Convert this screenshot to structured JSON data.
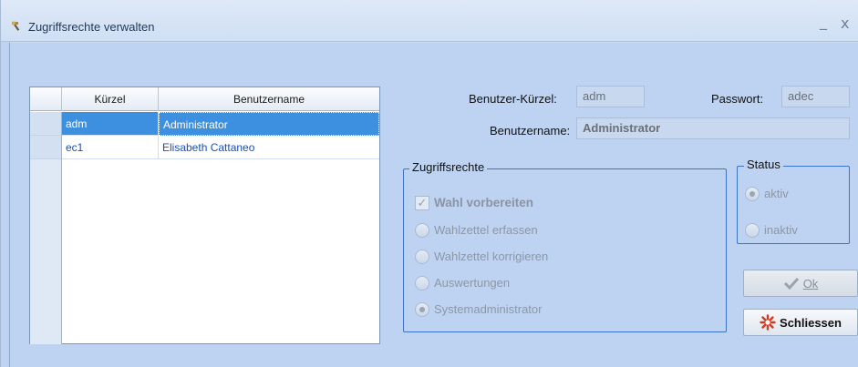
{
  "window": {
    "title": "Zugriffsrechte verwalten",
    "minimize_glyph": "_",
    "close_glyph": "x"
  },
  "grid": {
    "columns": [
      "Kürzel",
      "Benutzername"
    ],
    "rows": [
      {
        "kuerzel": "adm",
        "benutzername": "Administrator",
        "selected": true
      },
      {
        "kuerzel": "ec1",
        "benutzername": "Elisabeth Cattaneo",
        "selected": false
      }
    ]
  },
  "form": {
    "kuerzel_label": "Benutzer-Kürzel:",
    "kuerzel_value": "adm",
    "passwort_label": "Passwort:",
    "passwort_value": "adec",
    "benutzername_label": "Benutzername:",
    "benutzername_value": "Administrator"
  },
  "zugriffsrechte": {
    "title": "Zugriffsrechte",
    "checkbox": {
      "label": "Wahl vorbereiten",
      "checked": true
    },
    "options": [
      {
        "label": "Wahlzettel erfassen",
        "checked": false
      },
      {
        "label": "Wahlzettel korrigieren",
        "checked": false
      },
      {
        "label": "Auswertungen",
        "checked": false
      },
      {
        "label": "Systemadministrator",
        "checked": true
      }
    ]
  },
  "status": {
    "title": "Status",
    "options": [
      {
        "label": "aktiv",
        "checked": true
      },
      {
        "label": "inaktiv",
        "checked": false
      }
    ]
  },
  "buttons": {
    "ok_label": "Ok",
    "close_label": "Schliessen"
  },
  "colors": {
    "accent": "#3d8fe0",
    "group_border": "#3f73c6",
    "background": "#bdd3f1"
  }
}
